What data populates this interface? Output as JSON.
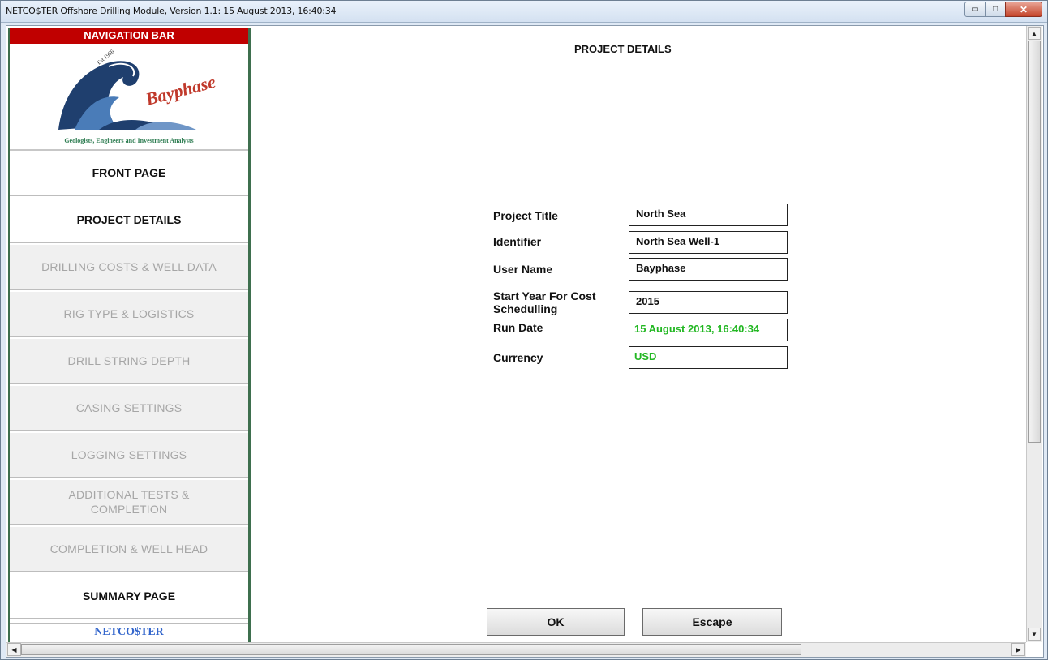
{
  "window": {
    "title": "NETCO$TER Offshore Drilling Module, Version 1.1: 15 August 2013, 16:40:34",
    "controls": {
      "minimize": "▭",
      "maximize": "□",
      "close": "✕"
    }
  },
  "nav": {
    "header": "NAVIGATION BAR",
    "logo": {
      "name": "Bayphase",
      "est": "Est.1986",
      "caption": "Geologists, Engineers and Investment Analysts"
    },
    "items": [
      {
        "label": "FRONT PAGE",
        "state": "enabled"
      },
      {
        "label": "PROJECT DETAILS",
        "state": "enabled"
      },
      {
        "label": "DRILLING COSTS & WELL DATA",
        "state": "disabled"
      },
      {
        "label": "RIG TYPE & LOGISTICS",
        "state": "disabled"
      },
      {
        "label": "DRILL STRING DEPTH",
        "state": "disabled"
      },
      {
        "label": "CASING SETTINGS",
        "state": "disabled"
      },
      {
        "label": "LOGGING SETTINGS",
        "state": "disabled"
      },
      {
        "label": "ADDITIONAL TESTS & COMPLETION",
        "state": "disabled"
      },
      {
        "label": "COMPLETION & WELL HEAD",
        "state": "disabled"
      },
      {
        "label": "SUMMARY PAGE",
        "state": "enabled"
      }
    ],
    "footer": "NETCO$TER"
  },
  "main": {
    "title": "PROJECT DETAILS",
    "fields": [
      {
        "label": "Project Title",
        "value": "North Sea"
      },
      {
        "label": "Identifier",
        "value": "North Sea Well-1"
      },
      {
        "label": "User Name",
        "value": "Bayphase"
      },
      {
        "label": "Start Year For Cost Schedulling",
        "value": "2015"
      },
      {
        "label": "Run Date",
        "value": "15 August 2013, 16:40:34"
      },
      {
        "label": "Currency",
        "value": "USD"
      }
    ],
    "buttons": {
      "ok": "OK",
      "escape": "Escape"
    }
  },
  "colors": {
    "nav_header": "#c00000",
    "nav_border": "#3e6f4e",
    "computed_value": "#22b722",
    "footer_brand": "#3366cc",
    "logo_red": "#c0392b"
  }
}
